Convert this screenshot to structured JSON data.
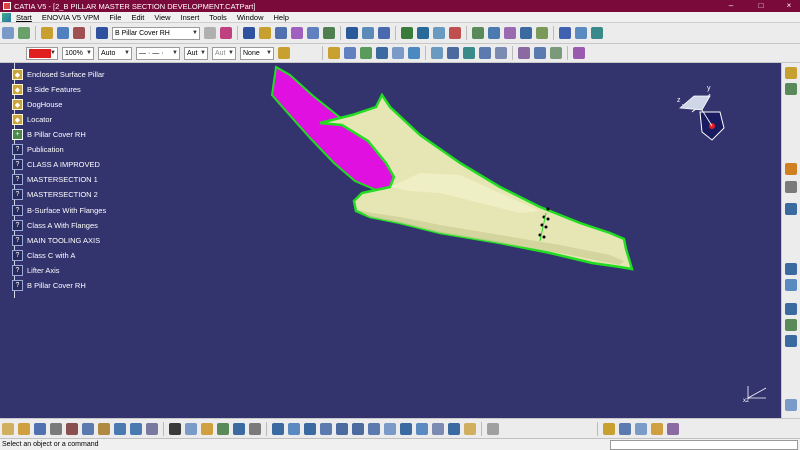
{
  "window": {
    "title": "CATIA V5 - [2_B PILLAR MASTER SECTION DEVELOPMENT.CATPart]",
    "minimize": "–",
    "maximize": "□",
    "close": "×"
  },
  "menu": {
    "items": [
      "Start",
      "ENOVIA V5 VPM",
      "File",
      "Edit",
      "View",
      "Insert",
      "Tools",
      "Window",
      "Help"
    ]
  },
  "toolbar_combo": {
    "current_body": "B Pillar Cover RH"
  },
  "graphic_props": {
    "color": "#e02020",
    "transparency": "100%",
    "thickness": "Auto",
    "line_type": "— · — ·",
    "point_type": "Aut",
    "layer_auto": "Aut",
    "layer": "None"
  },
  "tree": {
    "items": [
      {
        "label": "Enclosed Surface Pillar",
        "icon": "geometrical-set-icon",
        "kind": "feat"
      },
      {
        "label": "B Side Features",
        "icon": "geometrical-set-icon",
        "kind": "feat"
      },
      {
        "label": "DogHouse",
        "icon": "geometrical-set-icon",
        "kind": "feat"
      },
      {
        "label": "Locator",
        "icon": "geometrical-set-icon",
        "kind": "feat"
      },
      {
        "label": "B Pillar Cover RH",
        "icon": "part-body-icon",
        "kind": "plus"
      },
      {
        "label": "Publication",
        "icon": "publication-icon",
        "kind": "pub"
      },
      {
        "label": "CLASS A IMPROVED",
        "icon": "publication-item-icon",
        "kind": "pub"
      },
      {
        "label": "MASTERSECTION 1",
        "icon": "publication-item-icon",
        "kind": "pub"
      },
      {
        "label": "MASTERSECTION 2",
        "icon": "publication-item-icon",
        "kind": "pub"
      },
      {
        "label": "B-Surface With Flanges",
        "icon": "publication-item-icon",
        "kind": "pub"
      },
      {
        "label": "Class A With Flanges",
        "icon": "publication-item-icon",
        "kind": "pub"
      },
      {
        "label": "MAIN TOOLING AXIS",
        "icon": "publication-item-icon",
        "kind": "pub"
      },
      {
        "label": "Class C with A",
        "icon": "publication-item-icon",
        "kind": "pub"
      },
      {
        "label": "Lifter Axis",
        "icon": "publication-item-icon",
        "kind": "pub"
      },
      {
        "label": "B Pillar Cover RH",
        "icon": "publication-item-icon",
        "kind": "pub"
      }
    ]
  },
  "compass": {
    "x_label": "x",
    "y_label": "y",
    "z_label": "z"
  },
  "status": {
    "message": "Select an object or a command"
  },
  "colors": {
    "viewport_bg": "#33336e",
    "surface": "#e6e6b4",
    "highlight_edge": "#22dd22",
    "magenta_face": "#e010e0"
  }
}
